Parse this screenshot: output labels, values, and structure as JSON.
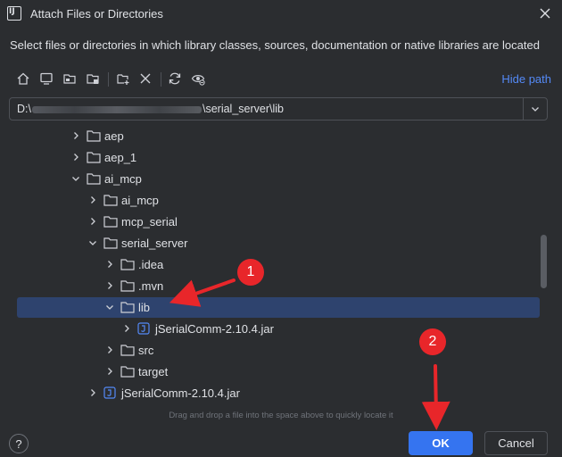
{
  "window": {
    "title": "Attach Files or Directories",
    "logo_text": "IJ"
  },
  "description": "Select files or directories in which library classes, sources, documentation or native libraries are located",
  "toolbar": {
    "buttons": [
      "home-icon",
      "desktop-icon",
      "project-icon",
      "module-icon",
      "new-folder-icon",
      "delete-icon",
      "refresh-icon",
      "show-hidden-icon"
    ],
    "hide_path_label": "Hide path"
  },
  "path": {
    "prefix": "D:\\",
    "suffix": "\\serial_server\\lib"
  },
  "tree": [
    {
      "label": "aep",
      "type": "folder",
      "expanded": false,
      "depth": 0
    },
    {
      "label": "aep_1",
      "type": "folder",
      "expanded": false,
      "depth": 0
    },
    {
      "label": "ai_mcp",
      "type": "folder",
      "expanded": true,
      "depth": 0
    },
    {
      "label": "ai_mcp",
      "type": "folder",
      "expanded": false,
      "depth": 1
    },
    {
      "label": "mcp_serial",
      "type": "folder",
      "expanded": false,
      "depth": 1
    },
    {
      "label": "serial_server",
      "type": "folder",
      "expanded": true,
      "depth": 1
    },
    {
      "label": ".idea",
      "type": "folder",
      "expanded": false,
      "depth": 2
    },
    {
      "label": ".mvn",
      "type": "folder",
      "expanded": false,
      "depth": 2
    },
    {
      "label": "lib",
      "type": "folder",
      "expanded": true,
      "depth": 2,
      "selected": true
    },
    {
      "label": "jSerialComm-2.10.4.jar",
      "type": "jar",
      "expanded": false,
      "depth": 3
    },
    {
      "label": "src",
      "type": "folder",
      "expanded": false,
      "depth": 2
    },
    {
      "label": "target",
      "type": "folder",
      "expanded": false,
      "depth": 2
    },
    {
      "label": "jSerialComm-2.10.4.jar",
      "type": "jar",
      "expanded": false,
      "depth": 1
    }
  ],
  "hint": "Drag and drop a file into the space above to quickly locate it",
  "buttons": {
    "help": "?",
    "ok": "OK",
    "cancel": "Cancel"
  },
  "annotations": [
    {
      "number": "1"
    },
    {
      "number": "2"
    }
  ],
  "colors": {
    "background": "#2b2d30",
    "selection": "#2e436e",
    "accent": "#3574f0",
    "link": "#548af7",
    "annotation": "#e8262a"
  }
}
